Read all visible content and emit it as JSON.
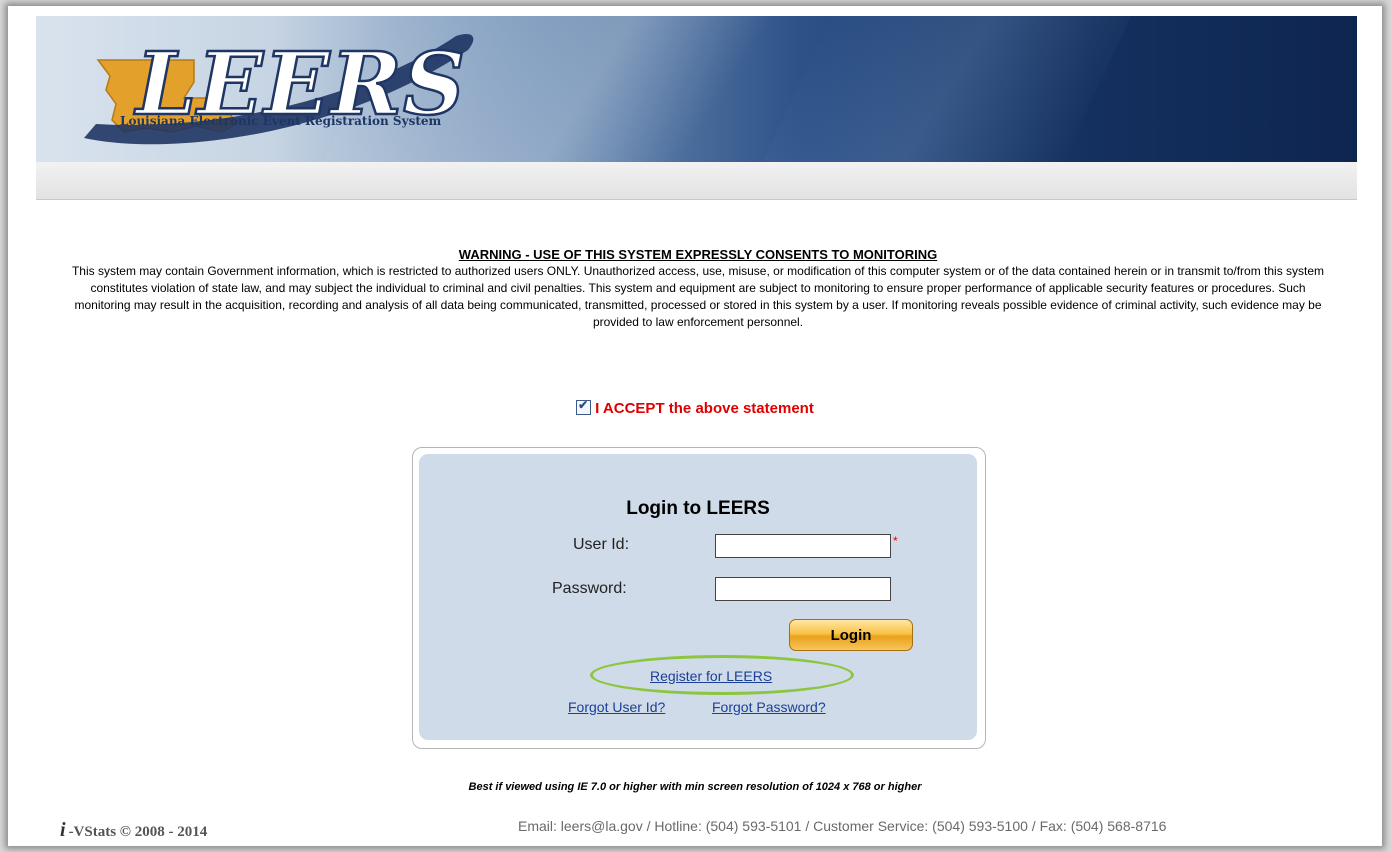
{
  "header": {
    "logo_text": "LEERS",
    "logo_tagline": "Louisiana Electronic Event Registration System"
  },
  "warning": {
    "title": "WARNING - USE OF THIS SYSTEM EXPRESSLY CONSENTS TO MONITORING",
    "body": "This system may contain Government information, which is restricted to authorized users ONLY. Unauthorized access, use, misuse, or modification of this computer system or of the data contained herein or in transmit to/from this system constitutes violation of state law, and may subject the individual to criminal and civil penalties. This system and equipment are subject to monitoring to ensure proper performance of applicable security features or procedures. Such monitoring may result in the acquisition, recording and analysis of all data being communicated, transmitted, processed or stored in this system by a user. If monitoring reveals possible evidence of criminal activity, such evidence may be provided to law enforcement personnel."
  },
  "accept": {
    "label": "I ACCEPT the above statement",
    "checked": true
  },
  "login": {
    "title": "Login to LEERS",
    "user_id_label": "User Id:",
    "user_id_value": "",
    "required_mark": "*",
    "password_label": "Password:",
    "password_value": "",
    "login_button": "Login",
    "register_link": "Register for LEERS",
    "forgot_user_link": "Forgot User Id?",
    "forgot_password_link": "Forgot Password?"
  },
  "footer": {
    "browser_note": "Best if viewed using IE 7.0 or higher with min screen resolution of 1024 x 768 or higher",
    "copyright_logo": "i",
    "copyright": "-VStats © 2008 - 2014",
    "contact": "Email: leers@la.gov / Hotline: (504) 593-5101 / Customer Service: (504) 593-5100 / Fax: (504) 568-8716"
  },
  "colors": {
    "accent_red": "#e00000",
    "link_blue": "#1c3f97",
    "login_panel": "#cfdbe8",
    "highlight_green": "#8cc63f",
    "logo_gold": "#e3a12b",
    "logo_navy": "#1f3563"
  }
}
